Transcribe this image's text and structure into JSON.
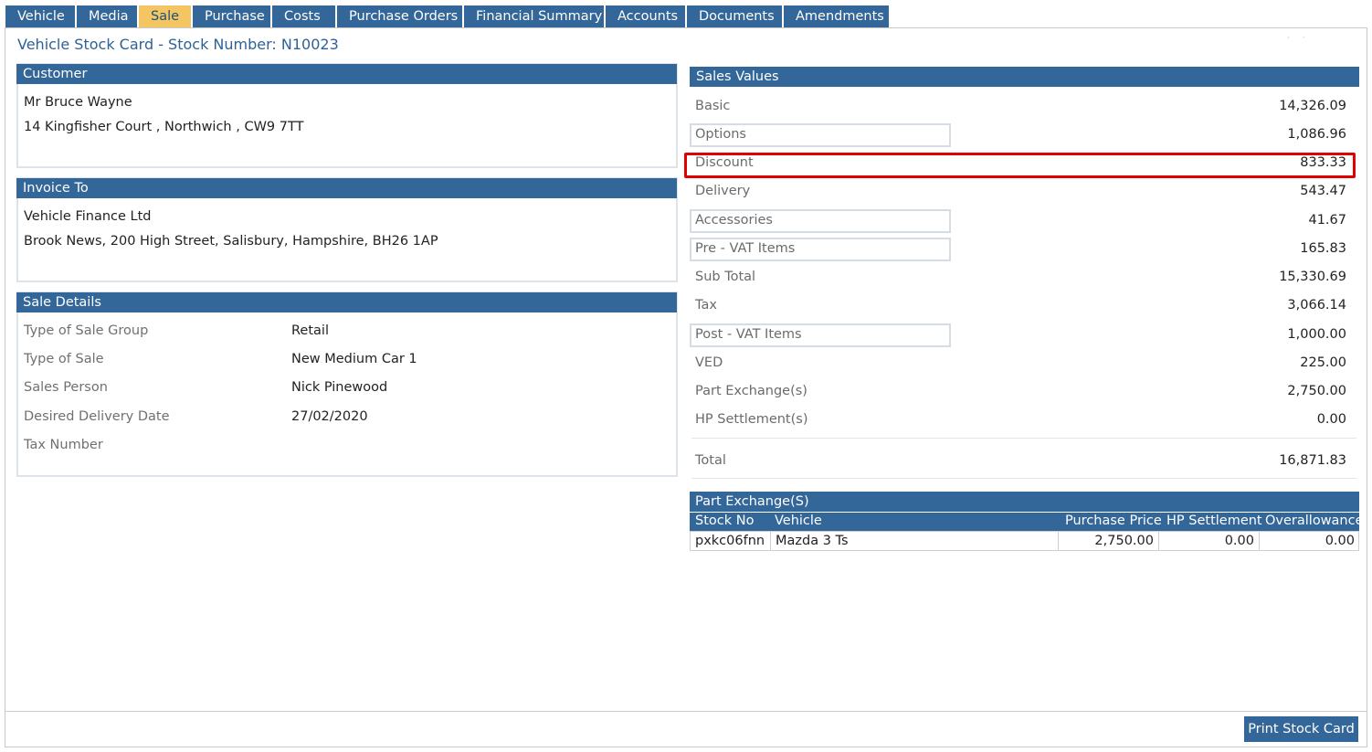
{
  "tabs": [
    "Vehicle",
    "Media",
    "Sale",
    "Purchase",
    "Costs",
    "Purchase Orders",
    "Financial Summary",
    "Accounts",
    "Documents",
    "Amendments"
  ],
  "active_tab": "Sale",
  "page_title": "Vehicle Stock Card - Stock Number: N10023",
  "customer": {
    "heading": "Customer",
    "name": "Mr Bruce Wayne",
    "address": "14 Kingfisher Court , Northwich , CW9 7TT"
  },
  "invoice_to": {
    "heading": "Invoice To",
    "name": "Vehicle Finance Ltd",
    "address": "Brook News, 200 High Street, Salisbury, Hampshire, BH26 1AP"
  },
  "sale_details": {
    "heading": "Sale Details",
    "rows": [
      {
        "label": "Type of Sale Group",
        "value": "Retail"
      },
      {
        "label": "Type of Sale",
        "value": "New Medium Car 1"
      },
      {
        "label": "Sales Person",
        "value": "Nick Pinewood"
      },
      {
        "label": "Desired Delivery Date",
        "value": "27/02/2020"
      },
      {
        "label": "Tax Number",
        "value": ""
      }
    ]
  },
  "sales_values": {
    "heading": "Sales Values",
    "rows": [
      {
        "label": "Basic",
        "value": "14,326.09"
      },
      {
        "label": "Options",
        "value": "1,086.96"
      },
      {
        "label": "Discount",
        "value": "833.33"
      },
      {
        "label": "Delivery",
        "value": "543.47"
      },
      {
        "label": "Accessories",
        "value": "41.67"
      },
      {
        "label": "Pre - VAT Items",
        "value": "165.83"
      },
      {
        "label": "Sub Total",
        "value": "15,330.69"
      },
      {
        "label": "Tax",
        "value": "3,066.14"
      },
      {
        "label": "Post - VAT Items",
        "value": "1,000.00"
      },
      {
        "label": "VED",
        "value": "225.00"
      },
      {
        "label": "Part Exchange(s)",
        "value": "2,750.00"
      },
      {
        "label": "HP Settlement(s)",
        "value": "0.00"
      },
      {
        "label": "Total",
        "value": "16,871.83"
      }
    ]
  },
  "part_exchange": {
    "heading": "Part Exchange(S)",
    "columns": [
      "Stock No",
      "Vehicle",
      "Purchase Price",
      "HP Settlement",
      "Overallowance"
    ],
    "rows": [
      {
        "stock_no": "pxkc06fnn",
        "vehicle": "Mazda 3 Ts",
        "purchase_price": "2,750.00",
        "hp_settlement": "0.00",
        "overallowance": "0.00"
      }
    ]
  },
  "print_button": "Print Stock Card",
  "colors": {
    "primary": "#336699",
    "active_tab": "#f3c663",
    "highlight": "#e00000"
  }
}
